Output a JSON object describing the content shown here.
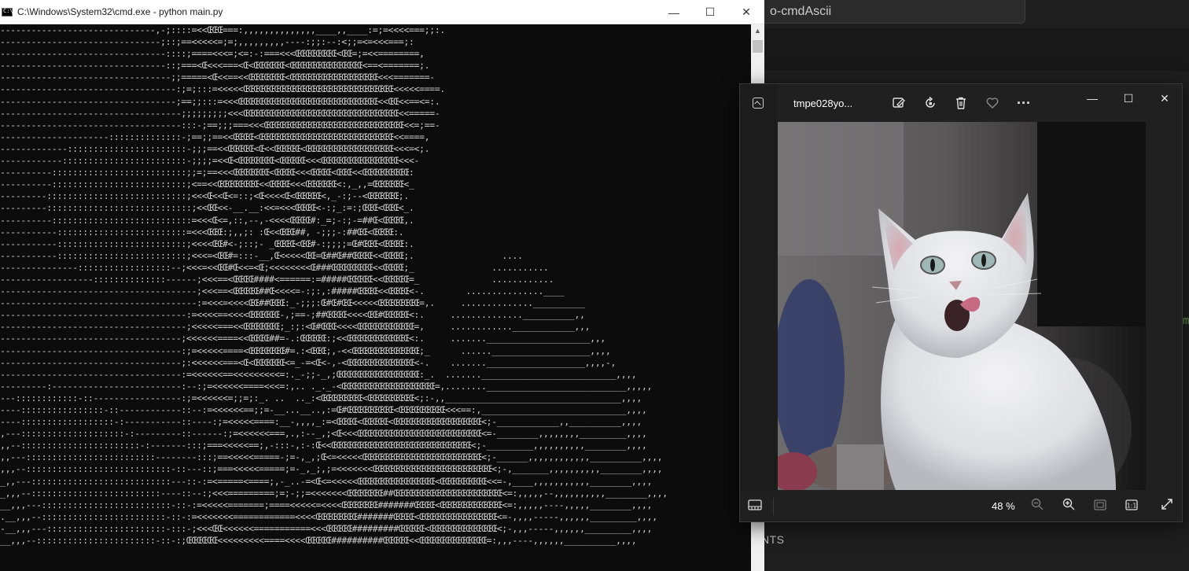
{
  "background_editor": {
    "search_text": "o-cmdAscii",
    "panel_label": "NTS",
    "green_char": "m"
  },
  "cmd": {
    "title": "C:\\Windows\\System32\\cmd.exe - python  main.py",
    "minimize": "—",
    "maximize": "☐",
    "close": "✕",
    "scroll_up": "▲",
    "ascii_lines": [
      "------------------------------,-;::::=<<ŒŒŒ===:,,,,,,,,,,,,,,____,,____:=;=<<<<===;;:.",
      "-------------------------------;::;==<<<<<=;=;,,,,,,,,,----:;;:--:<;;=<=<<<===;:",
      "--------------------------------::::;====<<<=;<=:-:===<<<ŒŒŒŒŒŒŒŒ<ŒŒ=;=<<========,",
      "--------------------------------::;===<Œ<<<===<Œ<ŒŒŒŒŒŒ<ŒŒŒŒŒŒŒŒŒŒŒŒŒŒ<==<=======;.",
      "---------------------------------;;=====<Œ<<==<<ŒŒŒŒŒŒŒ<ŒŒŒŒŒŒŒŒŒŒŒŒŒŒŒŒŒ<<<=======-",
      "----------------------------------:;=;:::=<<<<<ŒŒŒŒŒŒŒŒŒŒŒŒŒŒŒŒŒŒŒŒŒŒŒŒŒŒŒŒŒ<<<<<====.",
      "----------------------------------;==;;:::=<<<ŒŒŒŒŒŒŒŒŒŒŒŒŒŒŒŒŒŒŒŒŒŒŒŒŒŒŒ<<ŒŒ<<==<=:.",
      "-----------------------------------;;;;;;;;;<<<ŒŒŒŒŒŒŒŒŒŒŒŒŒŒŒŒŒŒŒŒŒŒŒŒŒŒŒŒŒŒ<<=====-",
      "-----------------------------------:::-;==;;;===<<<ŒŒŒŒŒŒŒŒŒŒŒŒŒŒŒŒŒŒŒŒŒŒŒŒŒŒŒ<<=;==-",
      "---------------------::::::::::::::-;==;;==<<ŒŒŒŒ<ŒŒŒŒŒŒŒŒŒŒŒŒŒŒŒŒŒŒŒŒŒŒŒŒŒŒ<<====,",
      "-------------:::::::::::::::::::::::-;;;==<<ŒŒŒŒŒ<Œ<<ŒŒŒŒŒ<ŒŒŒŒŒŒŒŒŒŒŒŒŒŒŒŒŒ<<<=<;.",
      "------------::::::::::::::::::::::::-;;;;=<<Œ<ŒŒŒŒŒŒŒ<ŒŒŒŒŒ<<<ŒŒŒŒŒŒŒŒŒŒŒŒŒŒŒ<<<-",
      "----------::::::::::::::::::::::::::;;=;==<<<ŒŒŒŒŒŒŒ<ŒŒŒŒ<<<ŒŒŒŒ<ŒŒŒ<<ŒŒŒŒŒŒŒŒŒ:",
      "----------::::::::::::::::::::::::::;<==<<ŒŒŒŒŒŒŒŒ<<ŒŒŒŒ<<<ŒŒŒŒŒŒ<:,_,,=ŒŒŒŒŒŒ<_",
      "---------:::::::::::::::::::::::::::;<<<Œ<<Œ<=::;<Œ<<<<Œ<ŒŒŒŒŒ<,_-:;--<ŒŒŒŒŒŒ;.",
      "---------::::::::::::::::::::::::::::;<<ŒŒ<<-__.__:<<=<<<ŒŒŒŒ<-:;_:=:;ŒŒŒ<ŒŒŒ<_.",
      "----------:::::::::::::::::::::::::::=<<<Œ<=,::,--,-<<<<ŒŒŒŒ#:_=;-:;-=##Œ<ŒŒŒŒ,.",
      "-----------:::::::::::::::::::::::::=<<<ŒŒŒ:;,,;: :Œ<<ŒŒŒ##, -;;;-:##ŒŒ<ŒŒŒŒ:.",
      "-----------:::::::::::::::::::::::::;<<<<ŒŒ#<-;::;- _ŒŒŒŒ<ŒŒ#-:;;;;=Œ#ŒŒŒ<ŒŒŒŒ:.",
      "-----------:::::::::::::::::::::::::;<<<=<ŒŒ#=:::-__,Œ<<<<<ŒŒ=Œ##Œ##ŒŒŒŒ<<ŒŒŒŒ;.                 ....",
      "---------------::::::::::::::::::--;<<<=<<ŒŒ#Œ<<=<Œ;<<<<<<<<Œ###ŒŒŒŒŒŒŒŒ<<ŒŒŒŒ;_               ...........",
      "------------------::::::::::::::------;<<<==<ŒŒŒŒ####<======:=#####ŒŒŒŒŒ<<ŒŒŒŒŒ=_              ............",
      "--------------------------------------;<<<==<ŒŒŒŒŒ##Œ<<<<=-:;:,:#####ŒŒŒŒ<<ŒŒŒŒ<-.        ...............____",
      "--------------------------------------:=<<<=<<<<ŒŒ##ŒŒŒ:_-;;;:Œ#Œ#ŒŒ<<<<<ŒŒŒŒŒŒŒŒ=,.     ..............__________",
      "------------------------------------:=<<<<==<<<<ŒŒŒŒŒŒ-,;==-;##ŒŒŒŒ<<<<ŒŒ#ŒŒŒŒŒ<:.     ..............__________,,",
      "------------------------------------;<<<<<===<<ŒŒŒŒŒŒŒ;_:;:<Œ#ŒŒŒ<<<<ŒŒŒŒŒŒŒŒŒŒŒ=,     ............____________,,,",
      "-----------------------------------;<<<<<<====<<ŒŒŒŒ##=-.:ŒŒŒŒŒ:;<<ŒŒŒŒŒŒŒŒŒŒŒŒ<:.     .......____________________,,,",
      "-----------------------------------:;=<<<<<====<ŒŒŒŒŒŒŒ#=.:<ŒŒŒ;,-<<ŒŒŒŒŒŒŒŒŒŒŒŒŒ;_      ......___________________,,,,",
      "-----------------------------------;:<<<<<<===<Œ<ŒŒŒŒŒŒ<=_-=<Œ<-,-<ŒŒŒŒŒŒŒŒŒŒŒŒŒ<-.    .......___________________,,,,-,",
      "-----------------------------------:=<<<<<<==<<<<<<<<<=:._-;;-_,;ŒŒŒŒŒŒŒŒŒŒŒŒŒŒŒŒ:_.  .......__________________________,,,,",
      "---------:-------------------------:--:;=<<<<<<====<<<=:,.. ._._-<ŒŒŒŒŒŒŒŒŒŒŒŒŒŒŒŒŒŒ=,........___________________________,,,,,",
      "---::::::::::::-::-----------------:;=<<<<<<=;;=;:_. ..  .._:<ŒŒŒŒŒŒŒŒ<ŒŒŒŒŒŒŒŒŒ<;:-,,__________________________________,,,,",
      "----::::::::::::::::-::------------::--:=<<<<<<==;;=-__...__..,:=Œ#ŒŒŒŒŒŒŒŒŒ<ŒŒŒŒŒŒŒŒŒ<<<==:,____________________________,,,,",
      "----::::::::::::::::::-:-----------::----:;=<<<<<====:__-,,,,_:=<ŒŒŒŒ<ŒŒŒŒŒ<ŒŒŒŒŒŒŒŒŒŒŒŒŒŒŒŒŒ<;-____________,,__________,,,,",
      ",---::::::::::::::::::::-:---------::------:;=<<<<<<===,.,:--_,;<Œ<<<ŒŒŒŒŒŒŒŒŒŒŒŒŒŒŒŒŒŒŒŒŒŒŒŒ<=-________,,,,,,,,_________,,,,",
      ",,--:::::::::::::::::::::::-:-------:::;===<<<<<==;,-:::-,:-:Œ<<ŒŒŒŒŒŒŒŒŒŒŒŒŒŒŒŒŒŒŒŒŒŒŒŒŒŒŒ<;-_________,,,,,,,,,,________,,,,",
      ",,---:::::::::::::::::::::::::--------:::;==<<<<<=====-;=-,_,;Œ<=<<<<<ŒŒŒŒŒŒŒŒŒŒŒŒŒŒŒŒŒŒŒŒŒŒŒ<;-______,,,,,,,,,,,,__________,,,,",
      ",,,--::::::::::::::::::::::::::::-::---::;===<<<<<=====;=-_,_;,;=<<<<<<<ŒŒŒŒŒŒŒŒŒŒŒŒŒŒŒŒŒŒŒŒŒŒŒ<;-,_______,,,,,,,,,,________,,,,",
      "_,,---:::::::::::::::::::::::::::---::-:=<=====<====;,-_..-=<Œ<=<<<<<ŒŒŒŒŒŒŒŒŒŒŒŒŒŒŒ<ŒŒŒŒŒŒŒŒŒ<<=-,____,,,,,,,,,,,________,,,,",
      "_,,,--:::::::::::::::::::::::::----::--:;<<<=========;=;-;;=<<<<<<<ŒŒŒŒŒŒŒ##ŒŒŒŒŒŒŒŒŒŒŒŒŒŒŒŒŒŒŒŒŒ<=:,,,,,--,,,,,,,,,,________,,,,",
      "__,,,---:::::::::::::::::::::::::-::-:=<<<<<=======;====<<<<<=<<<<ŒŒŒŒŒŒŒ#######ŒŒŒŒ<ŒŒŒŒŒŒŒŒŒŒŒŒ<=:,,,,,----,,,,,________,,,,",
      ".__,,,--::::::::::::::::::::::::-::-:=<<<<<<<============<<<<ŒŒŒŒŒŒŒŒ#######ŒŒŒŒ<ŒŒŒŒŒŒŒŒŒŒŒŒŒŒŒ<=-,,,,-----,,,,,,_________,,,,",
      "-__,,,---:::::::::::::::::::::::-:::-;<<<ŒŒ<<<<<<===========<<<ŒŒŒŒŒ#########ŒŒŒŒŒ<ŒŒŒŒŒŒŒŒŒŒŒŒŒ<;-,,,-----,,,,,,_________,,,,",
      "__,,,--:::::::::::::::::::::::-::-:;ŒŒŒŒŒŒ<<<<<<<<<====<<<<ŒŒŒŒŒ##########ŒŒŒŒŒ<<ŒŒŒŒŒŒŒŒŒŒŒŒŒ=:,,,----,,,,,,__________,,,,"
    ]
  },
  "photos": {
    "filename": "tmpe028yo...",
    "zoom": "48 %",
    "minimize": "—",
    "maximize": "☐",
    "close": "✕",
    "more": "···"
  }
}
